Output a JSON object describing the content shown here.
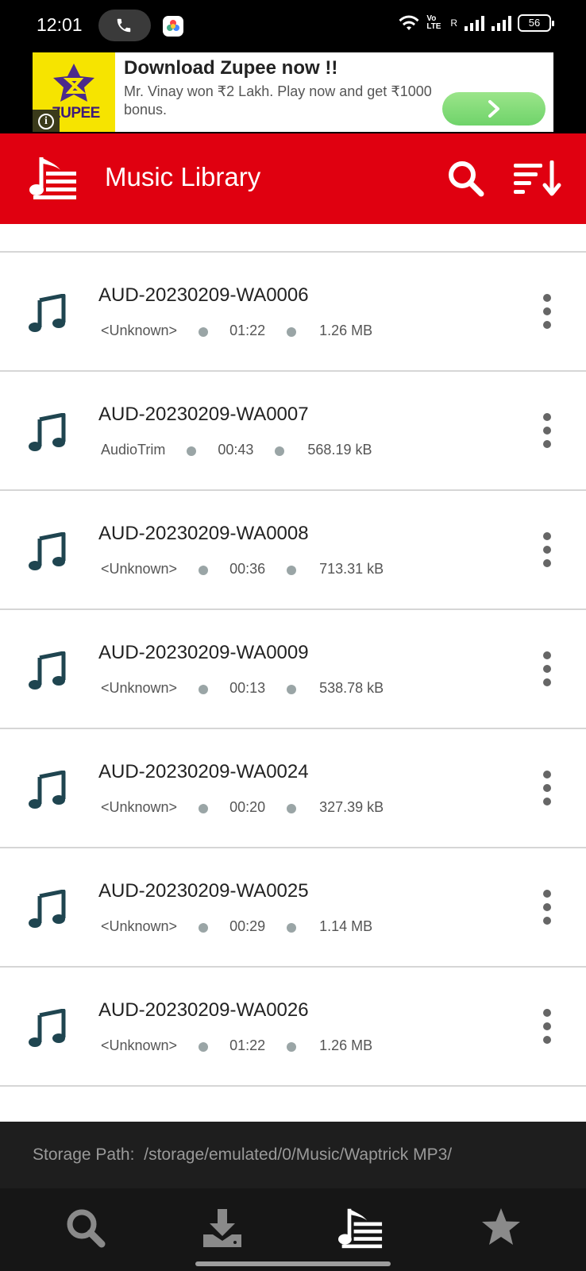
{
  "status_bar": {
    "time": "12:01",
    "volte": "Vo LTE",
    "sim_label": "R",
    "battery": "56"
  },
  "ad": {
    "brand": "ZUPEE",
    "title": "Download Zupee now !!",
    "description": "Mr. Vinay won ₹2 Lakh. Play now and get ₹1000 bonus.",
    "info": "i"
  },
  "appbar": {
    "title": "Music Library"
  },
  "tracks": [
    {
      "name": "AUD-20230209-WA0006",
      "artist": "<Unknown>",
      "duration": "01:22",
      "size": "1.26 MB"
    },
    {
      "name": "AUD-20230209-WA0007",
      "artist": "AudioTrim",
      "duration": "00:43",
      "size": "568.19 kB"
    },
    {
      "name": "AUD-20230209-WA0008",
      "artist": "<Unknown>",
      "duration": "00:36",
      "size": "713.31 kB"
    },
    {
      "name": "AUD-20230209-WA0009",
      "artist": "<Unknown>",
      "duration": "00:13",
      "size": "538.78 kB"
    },
    {
      "name": "AUD-20230209-WA0024",
      "artist": "<Unknown>",
      "duration": "00:20",
      "size": "327.39 kB"
    },
    {
      "name": "AUD-20230209-WA0025",
      "artist": "<Unknown>",
      "duration": "00:29",
      "size": "1.14 MB"
    },
    {
      "name": "AUD-20230209-WA0026",
      "artist": "<Unknown>",
      "duration": "01:22",
      "size": "1.26 MB"
    }
  ],
  "storage": {
    "label": "Storage Path:",
    "path": "/storage/emulated/0/Music/Waptrick MP3/"
  },
  "bottom_nav": [
    {
      "icon": "search-icon",
      "active": false
    },
    {
      "icon": "download-icon",
      "active": false
    },
    {
      "icon": "music-library-icon",
      "active": true
    },
    {
      "icon": "star-icon",
      "active": false
    }
  ],
  "colors": {
    "accent": "#e00010",
    "note_icon": "#1f4550",
    "dot": "#9aa5a6",
    "nav_active": "#ffffff",
    "nav_inactive": "#8a8a8a"
  }
}
